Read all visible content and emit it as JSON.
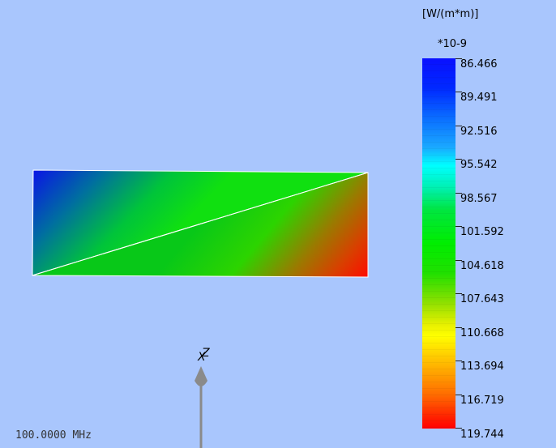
{
  "legend": {
    "unit": "[W/(m*m)]",
    "scale": "*10-9",
    "ticks": [
      "86.466",
      "89.491",
      "92.516",
      "95.542",
      "98.567",
      "101.592",
      "104.618",
      "107.643",
      "110.668",
      "113.694",
      "116.719",
      "119.744"
    ]
  },
  "axes": {
    "z_label": "Z",
    "x_label": "X"
  },
  "frequency": "100.0000 MHz",
  "colors": {
    "background": "#a9c6fd",
    "low": "#0000ff",
    "mid": "#00ee00",
    "high": "#ff0000",
    "axis_arrow": "#8a8a8a"
  }
}
